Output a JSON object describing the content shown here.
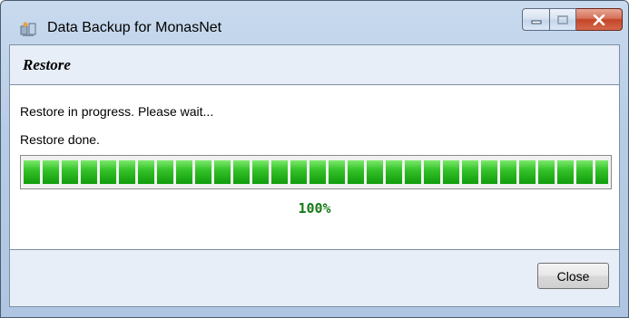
{
  "window": {
    "title": "Data Backup for MonasNet"
  },
  "caption_buttons": {
    "minimize_icon": "minimize-icon",
    "maximize_icon": "maximize-icon",
    "close_icon": "close-icon",
    "close_color": "#c44528"
  },
  "header": {
    "title": "Restore"
  },
  "status": {
    "line1": "Restore in progress. Please wait...",
    "line2": "Restore done."
  },
  "progress": {
    "value_percent": 100,
    "label": "100%",
    "fill_color": "#2ab51f"
  },
  "footer": {
    "close_label": "Close"
  }
}
